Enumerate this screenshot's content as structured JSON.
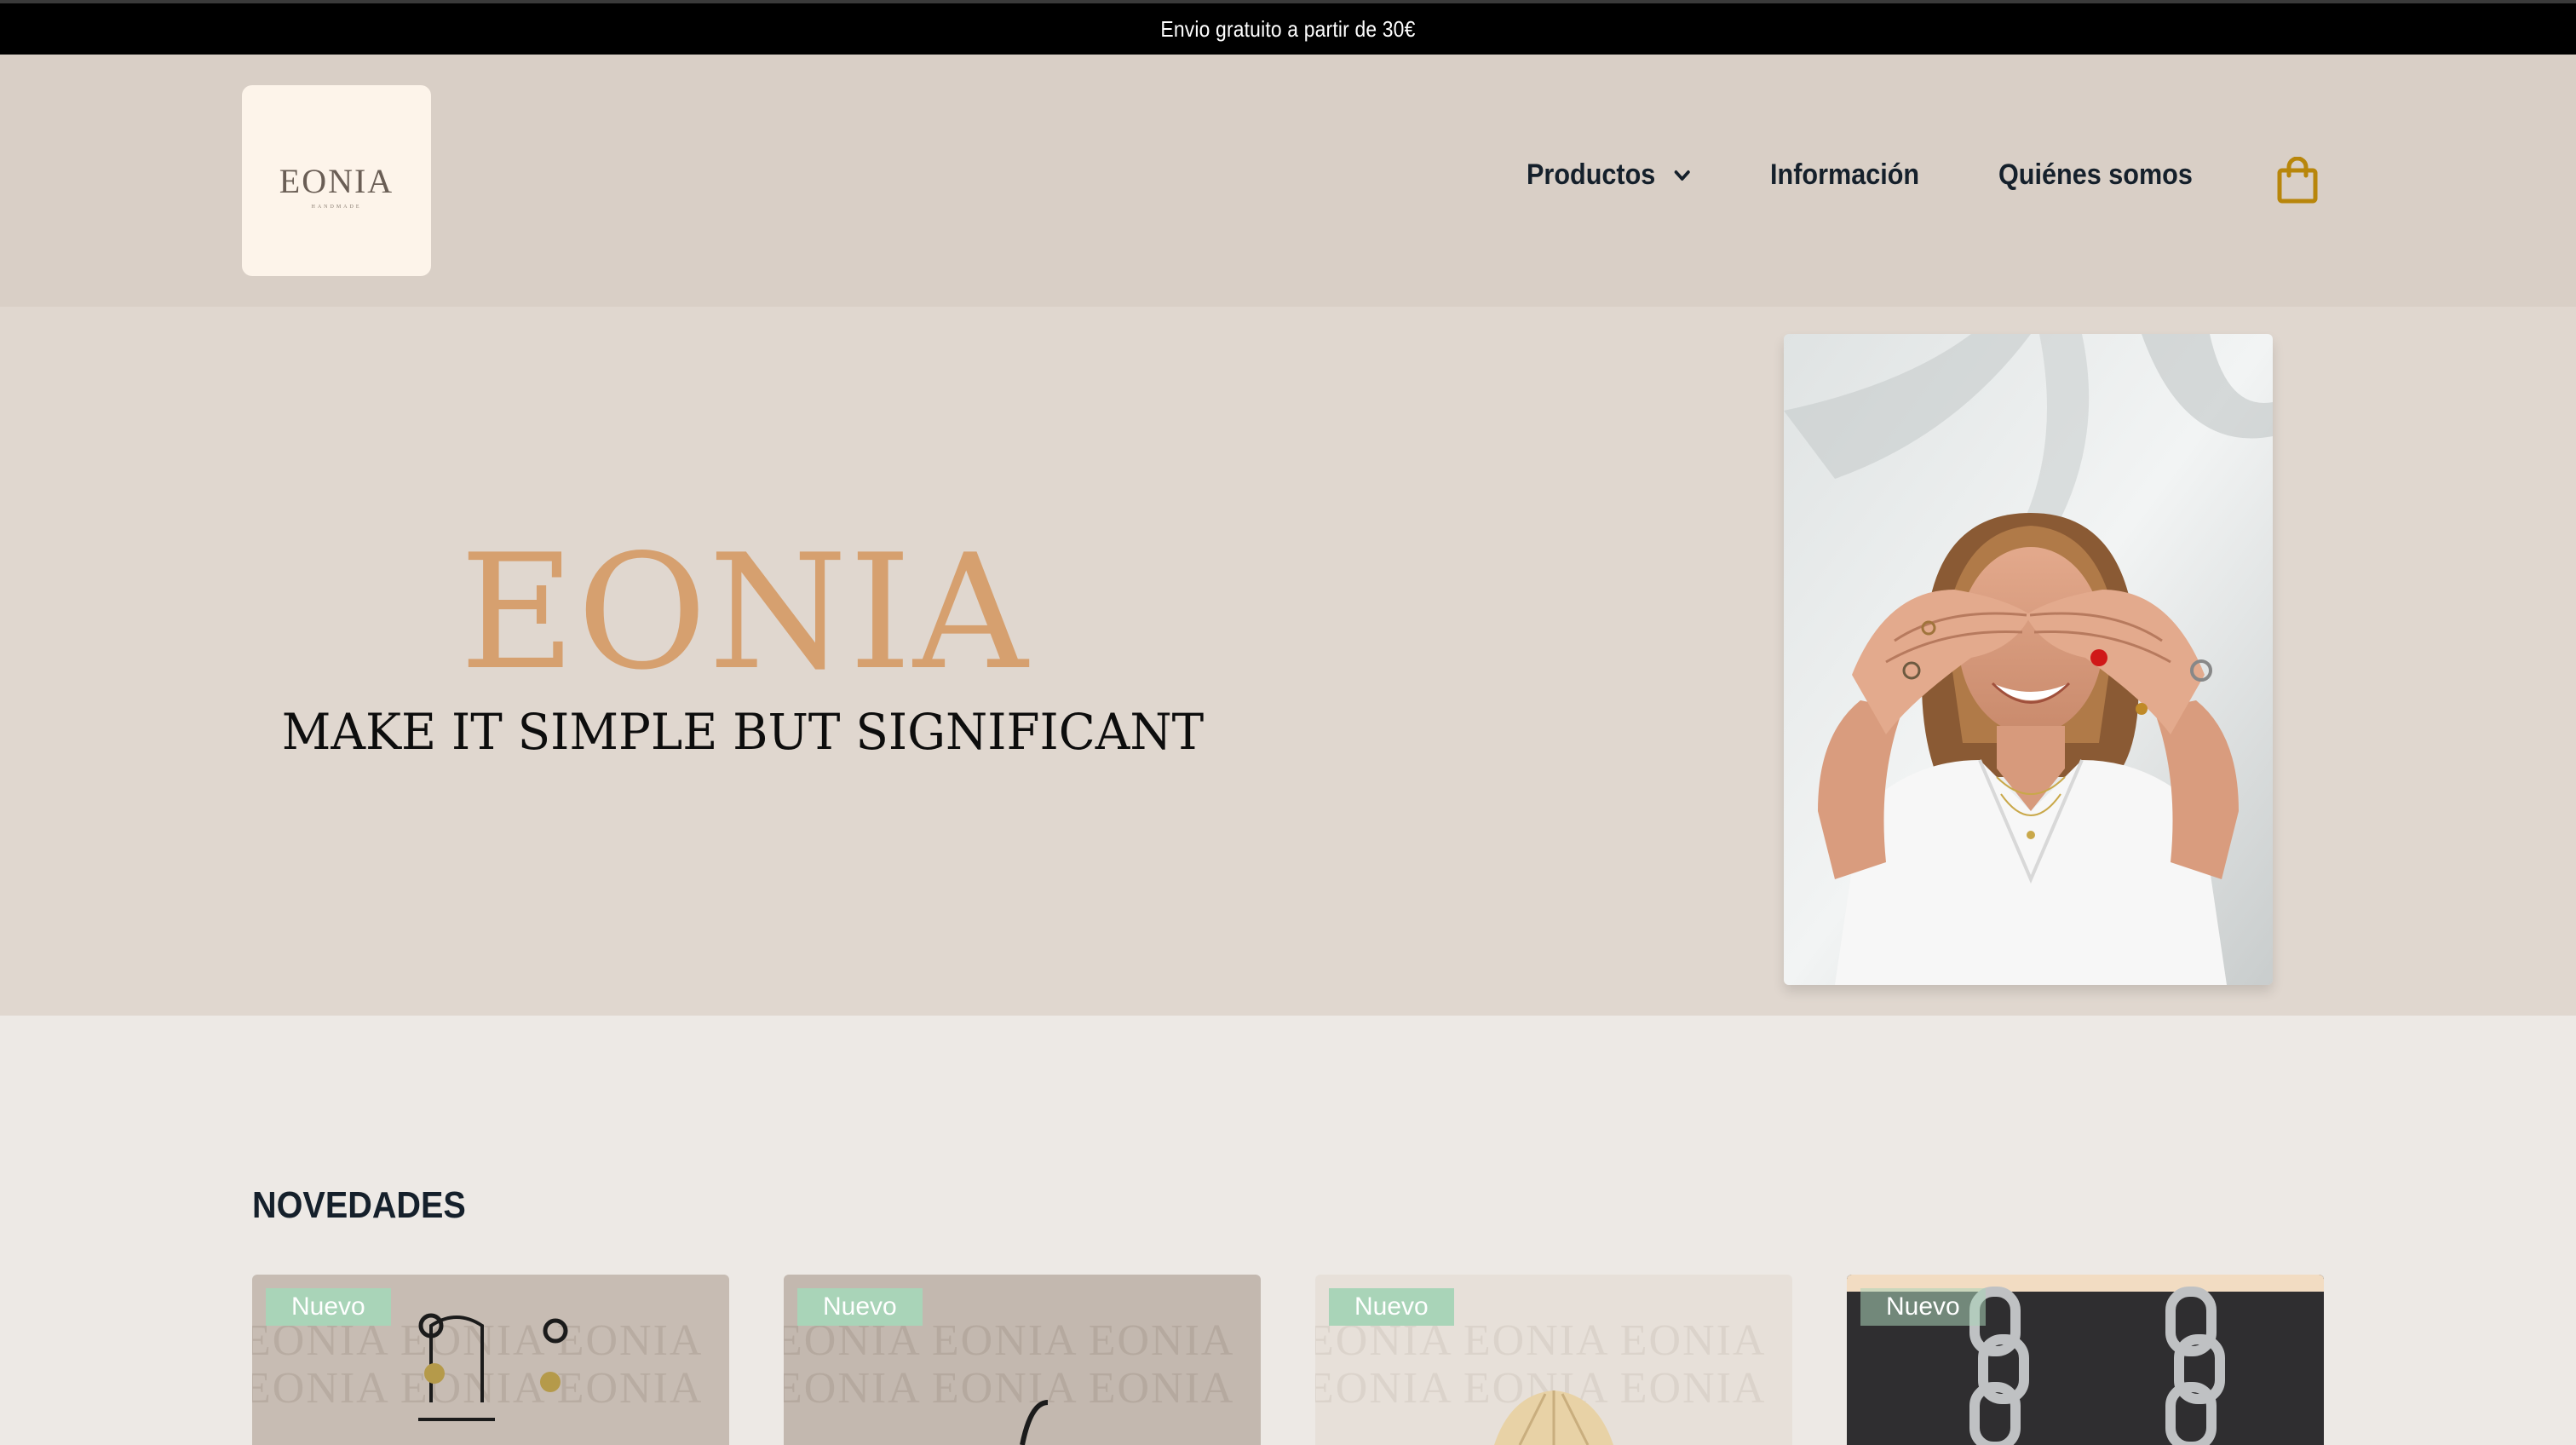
{
  "announcement": {
    "text": "Envio gratuito a partir de 30€"
  },
  "header": {
    "logo_text": "EONIA",
    "logo_subtext": "HANDMADE",
    "nav": [
      {
        "label": "Productos",
        "has_dropdown": true,
        "icon": "chevron-down-icon"
      },
      {
        "label": "Información"
      },
      {
        "label": "Quiénes somos"
      }
    ],
    "cart_icon": "shopping-bag-icon",
    "cart_color": "#b8860b"
  },
  "hero": {
    "title": "EONIA",
    "subtitle": "MAKE IT SIMPLE BUT SIGNIFICANT",
    "title_color": "#d6a06f",
    "photo_alt": "Woman covering her eyes with hands wearing rings"
  },
  "novedades": {
    "title": "NOVEDADES",
    "products": [
      {
        "badge": "Nuevo",
        "image": "earrings on stand"
      },
      {
        "badge": "Nuevo",
        "image": "jewelry on stand"
      },
      {
        "badge": "Nuevo",
        "image": "shell pendant"
      },
      {
        "badge": "Nuevo",
        "image": "chain earrings"
      }
    ],
    "badge_color": "#a9d4b8"
  },
  "colors": {
    "header_bg": "#d9cfc6",
    "hero_bg": "#e0d7cf",
    "page_bg": "#ede9e5",
    "text_dark": "#15202b"
  }
}
